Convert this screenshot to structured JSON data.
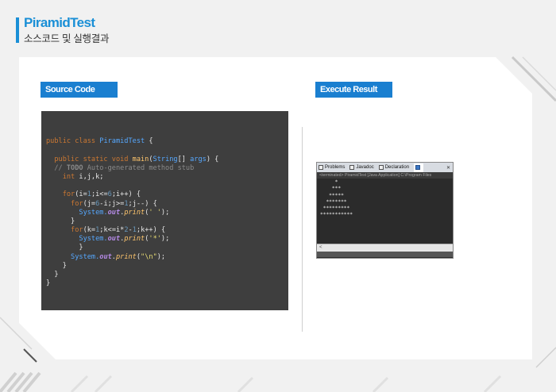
{
  "header": {
    "title": "PiramidTest",
    "subtitle": "소스코드 및 실행결과"
  },
  "labels": {
    "source": "Source Code",
    "execute": "Execute Result"
  },
  "code": {
    "lines": [
      [],
      [
        {
          "t": "public class ",
          "c": "kw"
        },
        {
          "t": "PiramidTest",
          "c": "cls"
        },
        {
          "t": " {",
          "c": "pl"
        }
      ],
      [],
      [
        {
          "t": "  public static void ",
          "c": "kw"
        },
        {
          "t": "main",
          "c": "fn"
        },
        {
          "t": "(",
          "c": "pl"
        },
        {
          "t": "String",
          "c": "type"
        },
        {
          "t": "[] ",
          "c": "pl"
        },
        {
          "t": "args",
          "c": "cls"
        },
        {
          "t": ") {",
          "c": "pl"
        }
      ],
      [
        {
          "t": "  // ",
          "c": "cm"
        },
        {
          "t": "TODO",
          "c": "todo"
        },
        {
          "t": " Auto-generated method stub",
          "c": "cm"
        }
      ],
      [
        {
          "t": "    int ",
          "c": "kw"
        },
        {
          "t": "i,j,k;",
          "c": "pl"
        }
      ],
      [],
      [
        {
          "t": "    for",
          "c": "kw"
        },
        {
          "t": "(i=",
          "c": "pl"
        },
        {
          "t": "1",
          "c": "num"
        },
        {
          "t": ";i<=",
          "c": "pl"
        },
        {
          "t": "6",
          "c": "num"
        },
        {
          "t": ";i++) {",
          "c": "pl"
        }
      ],
      [
        {
          "t": "      for",
          "c": "kw"
        },
        {
          "t": "(j=",
          "c": "pl"
        },
        {
          "t": "6",
          "c": "num"
        },
        {
          "t": "-i;j>=",
          "c": "pl"
        },
        {
          "t": "1",
          "c": "num"
        },
        {
          "t": ";j--) {",
          "c": "pl"
        }
      ],
      [
        {
          "t": "        System.",
          "c": "sys"
        },
        {
          "t": "out",
          "c": "out"
        },
        {
          "t": ".",
          "c": "pl"
        },
        {
          "t": "print",
          "c": "prn"
        },
        {
          "t": "(",
          "c": "pl"
        },
        {
          "t": "' '",
          "c": "str"
        },
        {
          "t": ");",
          "c": "pl"
        }
      ],
      [
        {
          "t": "      }",
          "c": "pl"
        }
      ],
      [
        {
          "t": "      for",
          "c": "kw"
        },
        {
          "t": "(k=",
          "c": "pl"
        },
        {
          "t": "1",
          "c": "num"
        },
        {
          "t": ";k<=i*",
          "c": "pl"
        },
        {
          "t": "2",
          "c": "num"
        },
        {
          "t": "-",
          "c": "pl"
        },
        {
          "t": "1",
          "c": "num"
        },
        {
          "t": ";k++) {",
          "c": "pl"
        }
      ],
      [
        {
          "t": "        System.",
          "c": "sys"
        },
        {
          "t": "out",
          "c": "out"
        },
        {
          "t": ".",
          "c": "pl"
        },
        {
          "t": "print",
          "c": "prn"
        },
        {
          "t": "(",
          "c": "pl"
        },
        {
          "t": "'*'",
          "c": "str"
        },
        {
          "t": ");",
          "c": "pl"
        }
      ],
      [
        {
          "t": "        }",
          "c": "pl"
        }
      ],
      [
        {
          "t": "      System.",
          "c": "sys"
        },
        {
          "t": "out",
          "c": "out"
        },
        {
          "t": ".",
          "c": "pl"
        },
        {
          "t": "print",
          "c": "prn"
        },
        {
          "t": "(",
          "c": "pl"
        },
        {
          "t": "\"\\n\"",
          "c": "str"
        },
        {
          "t": ");",
          "c": "pl"
        }
      ],
      [
        {
          "t": "    }",
          "c": "pl"
        }
      ],
      [
        {
          "t": "  }",
          "c": "pl"
        }
      ],
      [
        {
          "t": "}",
          "c": "pl"
        }
      ]
    ]
  },
  "console": {
    "tabs": [
      {
        "label": "Problems",
        "icon": "problems-icon",
        "active": false
      },
      {
        "label": "Javadoc",
        "icon": "javadoc-icon",
        "active": false
      },
      {
        "label": "Declaration",
        "icon": "declaration-icon",
        "active": false
      },
      {
        "label": "",
        "icon": "console-icon",
        "active": true
      }
    ],
    "controls": "✕",
    "status": "<terminated> PiramidTest [Java Application] C:\\Program Files",
    "output": "     *\n    ***\n   *****\n  *******\n *********\n***********",
    "scroll": "<"
  },
  "colors": {
    "accent": "#1a8fd6",
    "label_bg": "#1a7fd0",
    "code_bg": "#3e3e3e"
  }
}
